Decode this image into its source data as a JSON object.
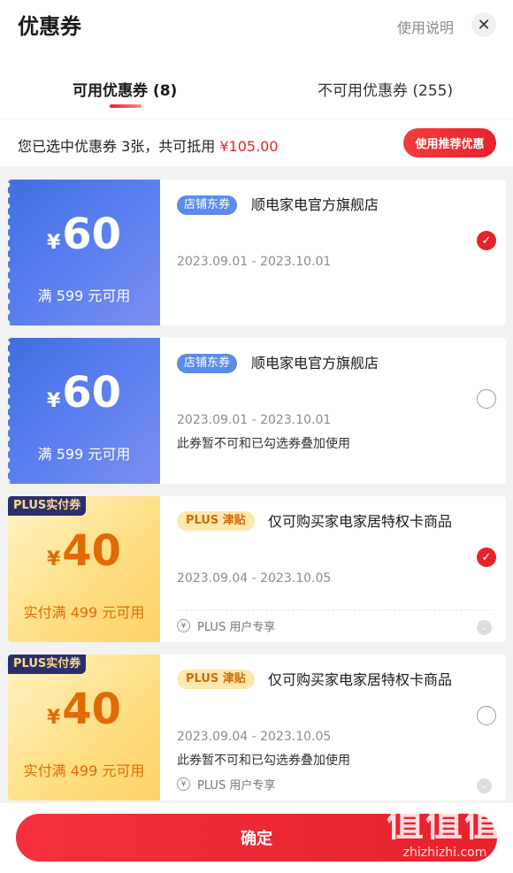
{
  "header": {
    "title": "优惠券",
    "help_label": "使用说明",
    "close_icon": "close-icon"
  },
  "tabs": [
    {
      "label": "可用优惠券 (8)",
      "active": true
    },
    {
      "label": "不可用优惠券 (255)",
      "active": false
    }
  ],
  "summary": {
    "text": "您已选中优惠券 3张，共可抵用",
    "amount": "¥105.00",
    "recommend_label": "使用推荐优惠"
  },
  "coupons": [
    {
      "type": "blue",
      "currency": "¥",
      "amount": "60",
      "condition": "满 599 元可用",
      "tag": "店铺东券",
      "store": "顺电家电官方旗舰店",
      "date": "2023.09.01 - 2023.10.01",
      "note": "",
      "checked": true
    },
    {
      "type": "blue",
      "currency": "¥",
      "amount": "60",
      "condition": "满 599 元可用",
      "tag": "店铺东券",
      "store": "顺电家电官方旗舰店",
      "date": "2023.09.01 - 2023.10.01",
      "note": "此券暂不可和已勾选券叠加使用",
      "checked": false
    },
    {
      "type": "gold",
      "plus_label": "PLUS实付券",
      "currency": "¥",
      "amount": "40",
      "condition": "实付满 499 元可用",
      "tag": "PLUS 津贴",
      "store": "仅可购买家电家居特权卡商品",
      "date": "2023.09.04 - 2023.10.05",
      "note": "",
      "exclusive": "PLUS 用户专享",
      "checked": true
    },
    {
      "type": "gold",
      "plus_label": "PLUS实付券",
      "currency": "¥",
      "amount": "40",
      "condition": "实付满 499 元可用",
      "tag": "PLUS 津贴",
      "store": "仅可购买家电家居特权卡商品",
      "date": "2023.09.04 - 2023.10.05",
      "note": "此券暂不可和已勾选券叠加使用",
      "exclusive": "PLUS 用户专享",
      "checked": false
    }
  ],
  "confirm_label": "确定",
  "watermark": {
    "big": "值值值",
    "small": "zhizhizhi.com"
  },
  "colors": {
    "accent": "#e8222c",
    "blue_coupon": "#4a74e6",
    "gold_coupon": "#ffd86e"
  }
}
